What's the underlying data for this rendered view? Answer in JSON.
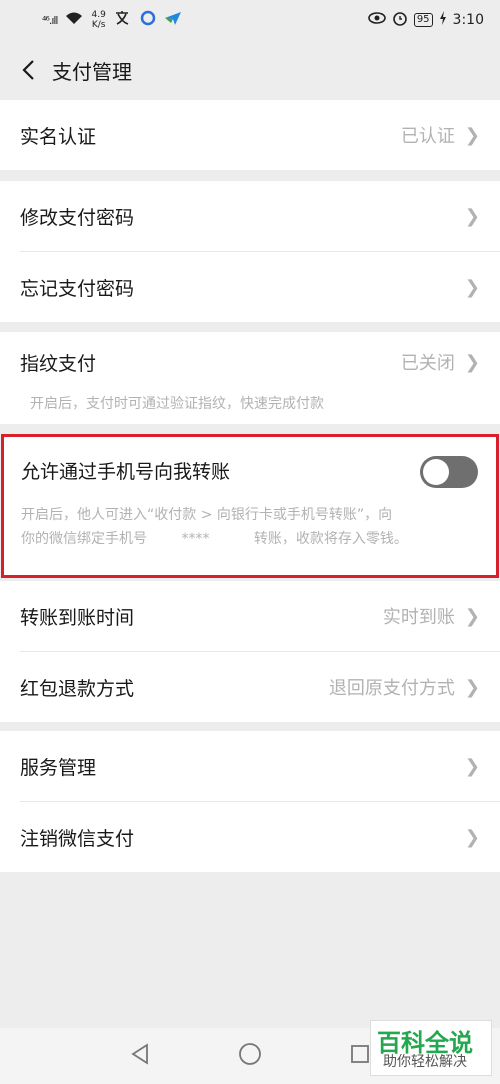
{
  "status_bar": {
    "signal_label": "⁴⁶.ıll",
    "net_speed_top": "4.9",
    "net_speed_bottom": "K/s",
    "battery": "95",
    "time": "3:10"
  },
  "header": {
    "title": "支付管理"
  },
  "rows": {
    "real_name": {
      "label": "实名认证",
      "value": "已认证"
    },
    "change_password": {
      "label": "修改支付密码"
    },
    "forgot_password": {
      "label": "忘记支付密码"
    },
    "fingerprint": {
      "label": "指纹支付",
      "value": "已关闭",
      "description": "开启后，支付时可通过验证指纹，快速完成付款"
    },
    "phone_transfer": {
      "label": "允许通过手机号向我转账",
      "enabled": false,
      "description_line1": "开启后，他人可进入“收付款 > 向银行卡或手机号转账”，向",
      "description_line2": "你的微信绑定手机号",
      "masked_number": "****",
      "description_line2b": "转账，收款将存入零钱。"
    },
    "transfer_time": {
      "label": "转账到账时间",
      "value": "实时到账"
    },
    "refund_method": {
      "label": "红包退款方式",
      "value": "退回原支付方式"
    },
    "service_mgmt": {
      "label": "服务管理"
    },
    "cancel_pay": {
      "label": "注销微信支付"
    }
  },
  "watermark": {
    "title": "百科全说",
    "subtitle": "助你轻松解决"
  },
  "colors": {
    "highlight": "#d8202a",
    "watermark": "#23a84f"
  }
}
